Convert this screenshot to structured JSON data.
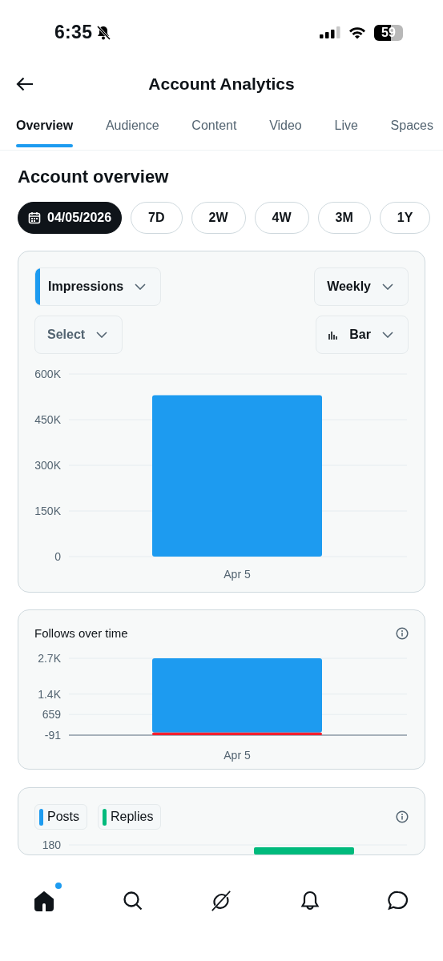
{
  "status_bar": {
    "time": "6:35",
    "battery": "59"
  },
  "header": {
    "title": "Account Analytics"
  },
  "tabs": [
    {
      "label": "Overview",
      "selected": true
    },
    {
      "label": "Audience",
      "selected": false
    },
    {
      "label": "Content",
      "selected": false
    },
    {
      "label": "Video",
      "selected": false
    },
    {
      "label": "Live",
      "selected": false
    },
    {
      "label": "Spaces",
      "selected": false
    }
  ],
  "section_title": "Account overview",
  "range_chips": [
    {
      "label": "04/05/2026",
      "kind": "date",
      "selected": true
    },
    {
      "label": "7D",
      "kind": "range",
      "selected": false
    },
    {
      "label": "2W",
      "kind": "range",
      "selected": false
    },
    {
      "label": "4W",
      "kind": "range",
      "selected": false
    },
    {
      "label": "3M",
      "kind": "range",
      "selected": false
    },
    {
      "label": "1Y",
      "kind": "range",
      "selected": false
    }
  ],
  "impressions_card": {
    "metric": "Impressions",
    "compare": {
      "placeholder": "Select"
    },
    "interval": "Weekly",
    "chart_type": "Bar",
    "chart_data": {
      "type": "bar",
      "categories": [
        "Apr 5"
      ],
      "grid": true,
      "series": [
        {
          "color": "#1d9bf0",
          "values": [
            530000
          ]
        }
      ],
      "ylim": [
        0,
        600000
      ],
      "yticks": [
        {
          "value": 0,
          "label": "0"
        },
        {
          "value": 150000,
          "label": "150K"
        },
        {
          "value": 300000,
          "label": "300K"
        },
        {
          "value": 450000,
          "label": "450K"
        },
        {
          "value": 600000,
          "label": "600K"
        }
      ]
    }
  },
  "follows_card": {
    "title": "Follows over time",
    "chart_data": {
      "type": "bar",
      "categories": [
        "Apr 5"
      ],
      "stacked": true,
      "grid": true,
      "series": [
        {
          "color": "#1d9bf0",
          "values": [
            2700
          ]
        },
        {
          "color": "#f4212e",
          "values": [
            -91
          ]
        }
      ],
      "ylim": [
        -91,
        2700
      ],
      "yticks": [
        {
          "value": -91,
          "label": "-91"
        },
        {
          "value": 659,
          "label": "659"
        },
        {
          "value": 1400,
          "label": "1.4K"
        },
        {
          "value": 2700,
          "label": "2.7K"
        }
      ]
    }
  },
  "posts_card": {
    "legend": [
      {
        "label": "Posts",
        "color": "#1d9bf0"
      },
      {
        "label": "Replies",
        "color": "#00ba7c"
      }
    ],
    "y_tick": "180"
  },
  "bottom_nav": [
    {
      "kind": "home",
      "selected": true,
      "badge": true
    },
    {
      "kind": "search",
      "selected": false
    },
    {
      "kind": "grok",
      "selected": false
    },
    {
      "kind": "notifications",
      "selected": false
    },
    {
      "kind": "messages",
      "selected": false
    }
  ]
}
